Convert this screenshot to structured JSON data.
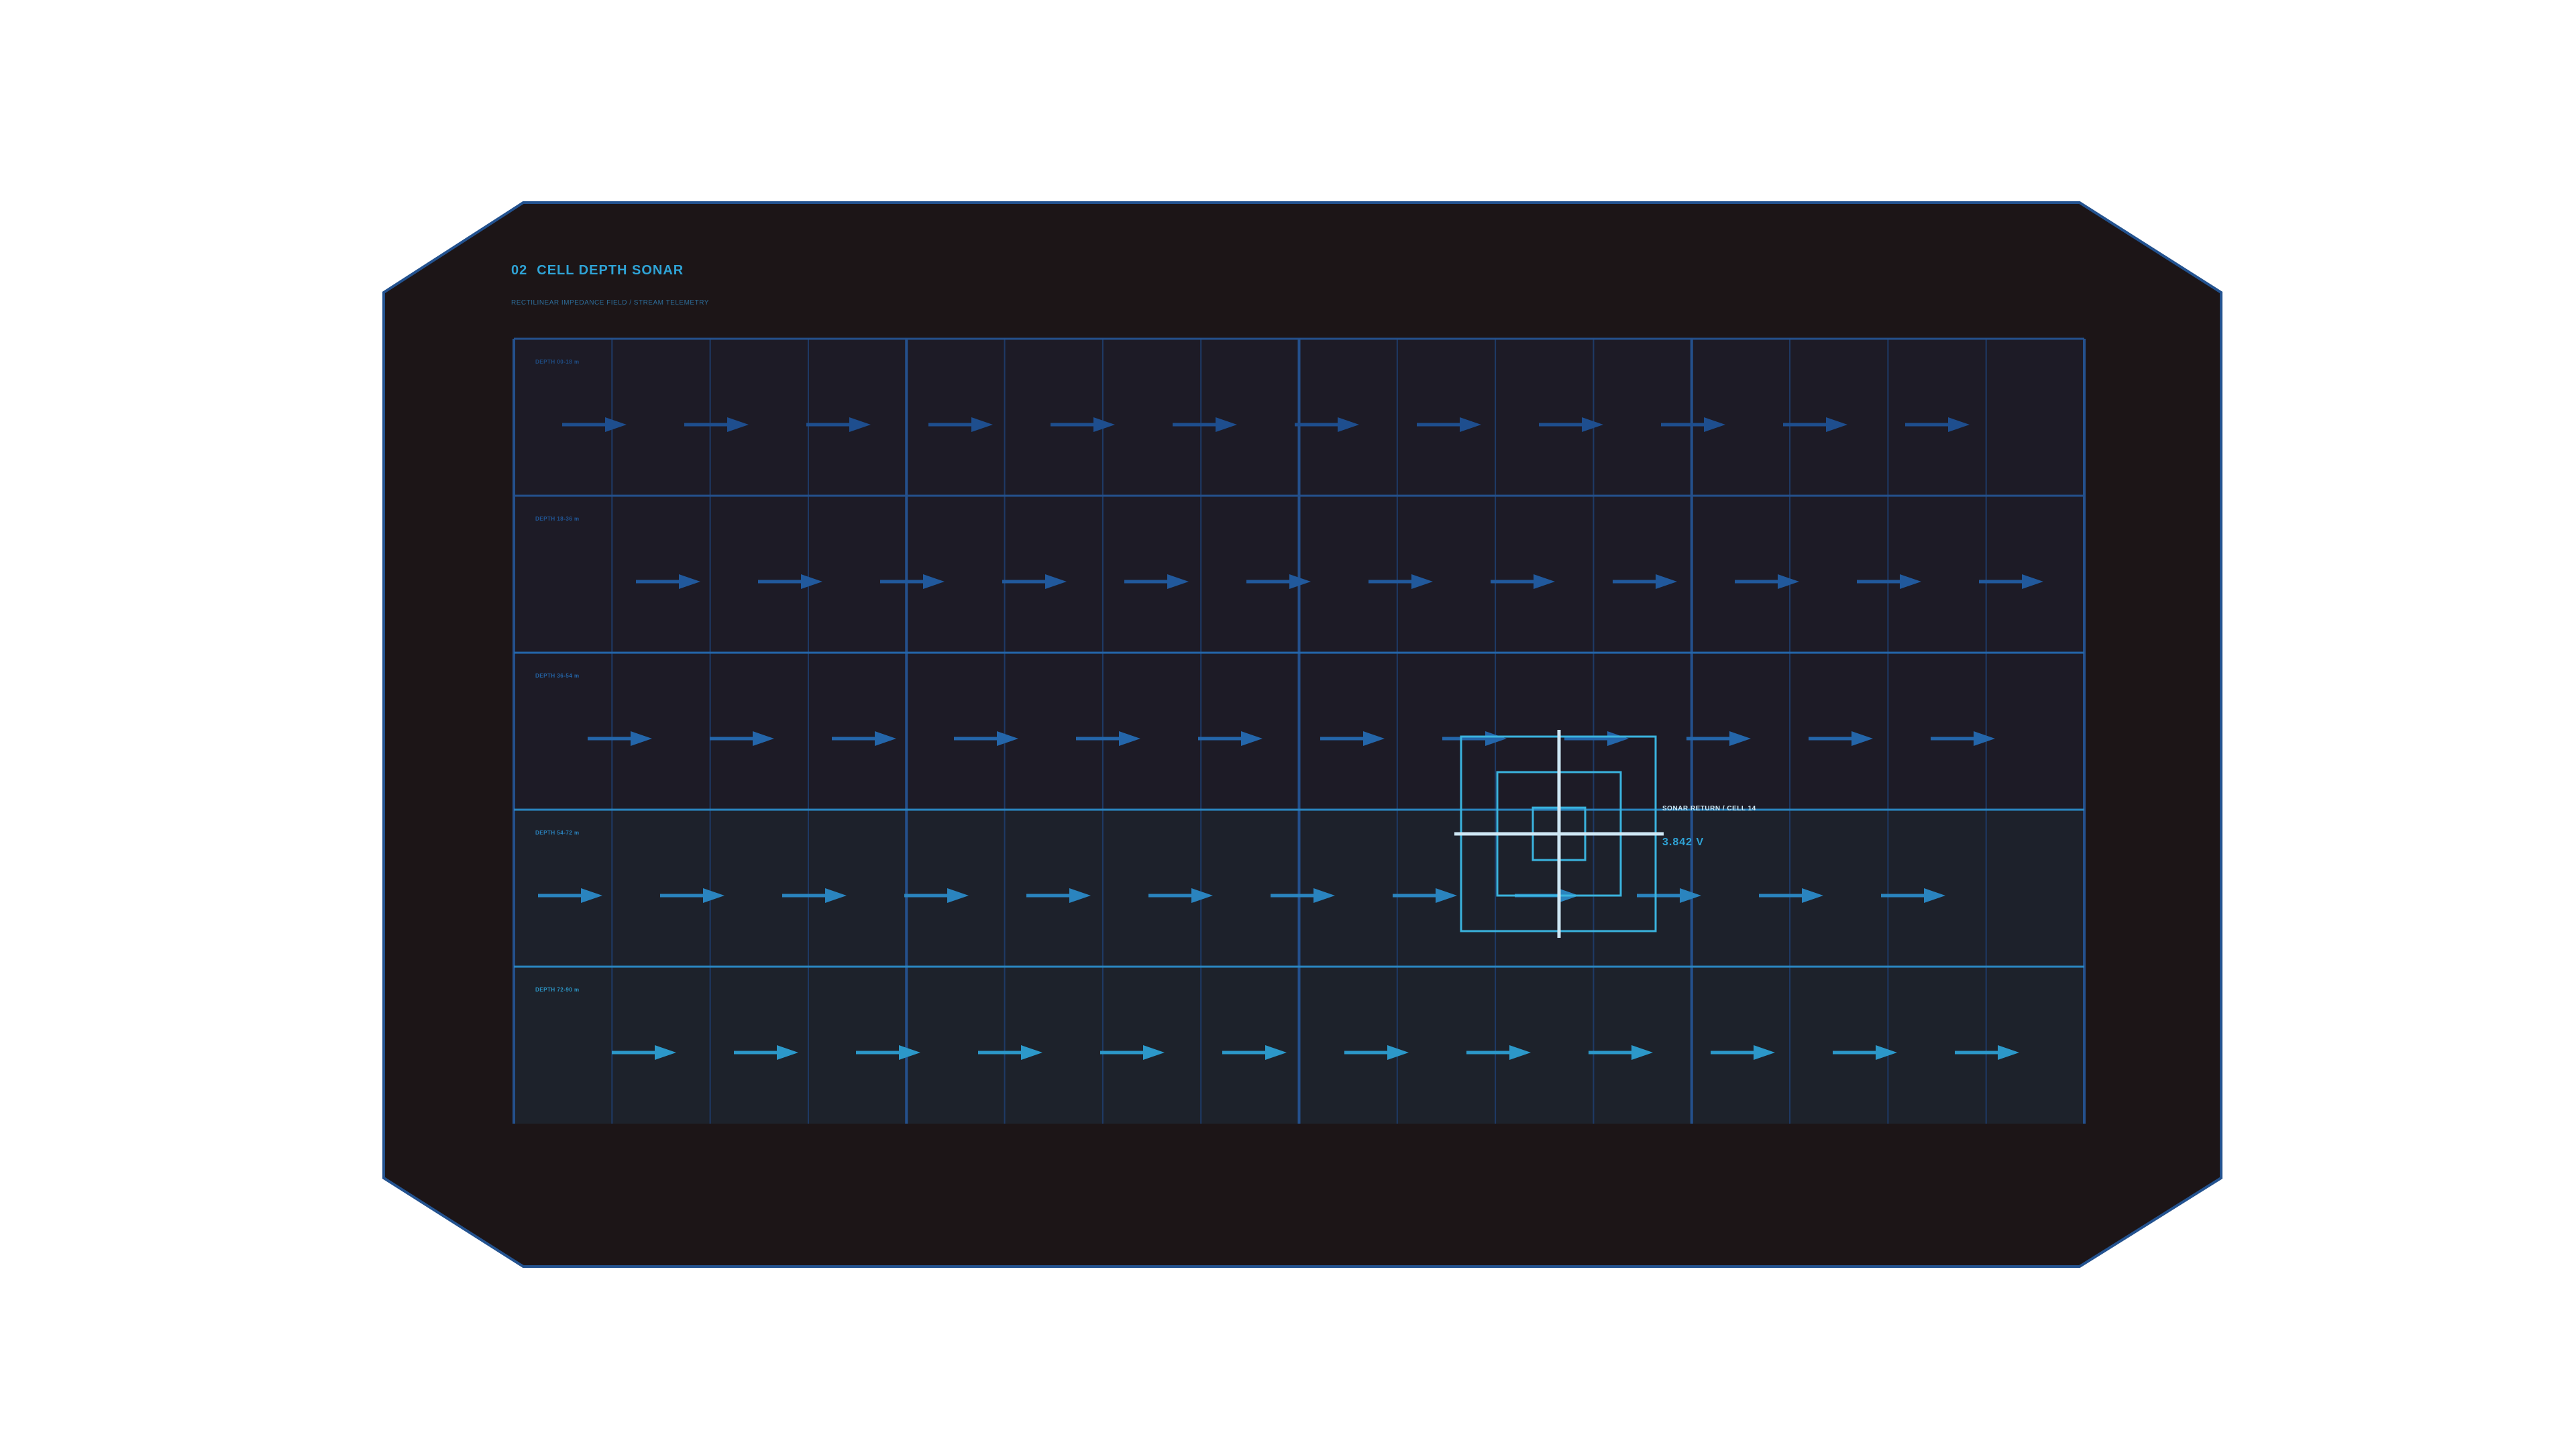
{
  "panel": {
    "number": "02",
    "title": "CELL DEPTH SONAR",
    "subtitle": "RECTILINEAR IMPEDANCE FIELD / STREAM TELEMETRY"
  },
  "bands": [
    {
      "label": "DEPTH 00-18 m",
      "arrow_color": "#1e4e8e",
      "label_color": "#1f4e86",
      "fill": "#1d1b26"
    },
    {
      "label": "DEPTH 18-36 m",
      "arrow_color": "#21599c",
      "label_color": "#21599c",
      "fill": "#1d1b26"
    },
    {
      "label": "DEPTH 36-54 m",
      "arrow_color": "#2466aa",
      "label_color": "#2466aa",
      "fill": "#1d1b26"
    },
    {
      "label": "DEPTH 54-72 m",
      "arrow_color": "#2a84bf",
      "label_color": "#2a84bf",
      "fill": "#1d212b"
    },
    {
      "label": "DEPTH 72-90 m",
      "arrow_color": "#2c98c9",
      "label_color": "#2c98c9",
      "fill": "#1d222b"
    }
  ],
  "sonar_return": {
    "label": "SONAR RETURN / CELL 14",
    "value": "3.842 V"
  },
  "colors": {
    "panel_fill": "#1c1517",
    "panel_border": "#23528f",
    "grid_major": "#24508c",
    "grid_minor": "#1e3a66",
    "band_divider": "#2a86c0",
    "reticle": "#3ab3de",
    "crosshair": "#cfe8f5"
  }
}
